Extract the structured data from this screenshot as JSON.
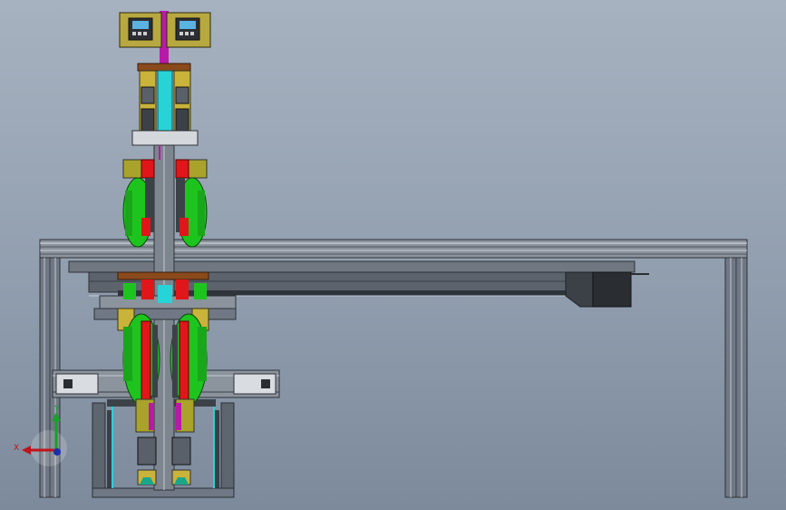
{
  "scene": {
    "background_top": "#a7b2c0",
    "background_bottom": "#7c8a9c"
  },
  "triad": {
    "x_label": "X",
    "y_label": "Y",
    "x_color": "#c0141c",
    "y_color": "#1a9e2c",
    "z_color": "#1c2ea8"
  },
  "palette": {
    "frame": "#6f7884",
    "frame_light": "#c3c9d0",
    "frame_dark": "#3a3f47",
    "wheel_green": "#1ec41e",
    "block_red": "#e0161a",
    "panel_yellow": "#c9b33a",
    "cyan": "#27d3d6",
    "magenta": "#b81aa8",
    "olive": "#a9a32b",
    "brown": "#8a4a1c"
  }
}
